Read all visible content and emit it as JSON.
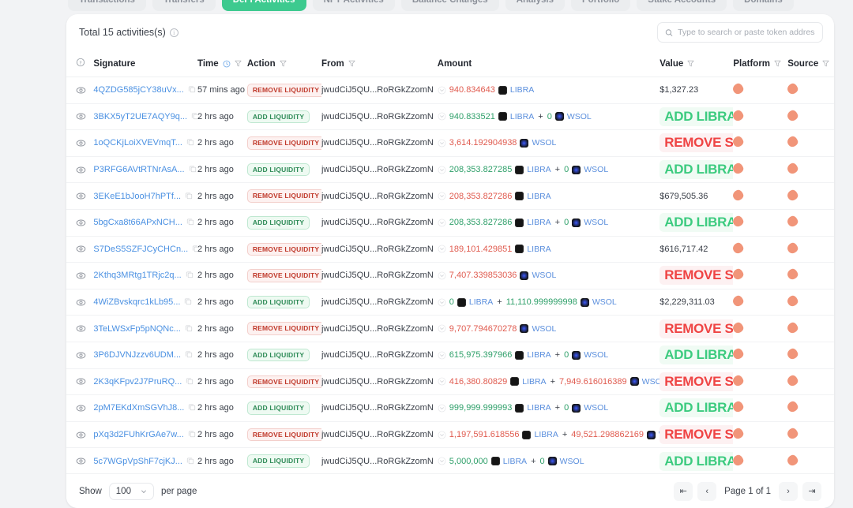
{
  "tabs": [
    {
      "label": "Transactions",
      "active": false
    },
    {
      "label": "Transfers",
      "active": false
    },
    {
      "label": "DeFi Activities",
      "active": true
    },
    {
      "label": "NFT Activities",
      "active": false
    },
    {
      "label": "Balance Changes",
      "active": false
    },
    {
      "label": "Analysis",
      "active": false
    },
    {
      "label": "Portfolio",
      "active": false
    },
    {
      "label": "Stake Accounts",
      "active": false
    },
    {
      "label": "Domains",
      "active": false
    }
  ],
  "header": {
    "total_label": "Total 15 activities(s)",
    "info_icon": "info-icon"
  },
  "search": {
    "placeholder": "Type to search or paste token address",
    "value": "",
    "icon": "search-icon"
  },
  "columns": [
    {
      "key": "eye",
      "label": ""
    },
    {
      "key": "signature",
      "label": "Signature"
    },
    {
      "key": "time",
      "label": "Time"
    },
    {
      "key": "action",
      "label": "Action"
    },
    {
      "key": "from",
      "label": "From"
    },
    {
      "key": "amount",
      "label": "Amount"
    },
    {
      "key": "value",
      "label": "Value"
    },
    {
      "key": "platform",
      "label": "Platform"
    },
    {
      "key": "source",
      "label": "Source"
    }
  ],
  "rows": [
    {
      "signature": "4QZDG585jCY38uVx...",
      "time": "57 mins ago",
      "action": "REMOVE LIQUIDITY",
      "action_type": "remove",
      "from": "jwudCiJ5QU...RoRGkZzomN",
      "amount": [
        {
          "num": "940.834643",
          "sign": "neg",
          "token": "LIBRA"
        }
      ],
      "value": "$1,327.23",
      "value_type": "plain",
      "platform": "platform-icon",
      "source": "source-icon"
    },
    {
      "signature": "3BKX5yT2UE7AQY9q...",
      "time": "2 hrs ago",
      "action": "ADD LIQUIDITY",
      "action_type": "add",
      "from": "jwudCiJ5QU...RoRGkZzomN",
      "amount": [
        {
          "num": "940.833521",
          "sign": "pos",
          "token": "LIBRA"
        },
        {
          "num": "0",
          "sign": "pos",
          "token": "WSOL"
        }
      ],
      "value": "ADD LIBRA",
      "value_type": "add",
      "platform": "platform-icon",
      "source": "source-icon"
    },
    {
      "signature": "1oQCKjLoiXVEVmqT...",
      "time": "2 hrs ago",
      "action": "REMOVE LIQUIDITY",
      "action_type": "remove",
      "from": "jwudCiJ5QU...RoRGkZzomN",
      "amount": [
        {
          "num": "3,614.192904938",
          "sign": "neg",
          "token": "WSOL"
        }
      ],
      "value": "REMOVE SOL",
      "value_type": "remove",
      "platform": "platform-icon",
      "source": "source-icon"
    },
    {
      "signature": "P3RFG6AVtRTNrAsA...",
      "time": "2 hrs ago",
      "action": "ADD LIQUIDITY",
      "action_type": "add",
      "from": "jwudCiJ5QU...RoRGkZzomN",
      "amount": [
        {
          "num": "208,353.827285",
          "sign": "pos",
          "token": "LIBRA"
        },
        {
          "num": "0",
          "sign": "pos",
          "token": "WSOL"
        }
      ],
      "value": "ADD LIBRA",
      "value_type": "add",
      "platform": "platform-icon",
      "source": "source-icon"
    },
    {
      "signature": "3EKeE1bJooH7hPTf...",
      "time": "2 hrs ago",
      "action": "REMOVE LIQUIDITY",
      "action_type": "remove",
      "from": "jwudCiJ5QU...RoRGkZzomN",
      "amount": [
        {
          "num": "208,353.827286",
          "sign": "neg",
          "token": "LIBRA"
        }
      ],
      "value": "$679,505.36",
      "value_type": "plain",
      "platform": "platform-icon",
      "source": "source-icon"
    },
    {
      "signature": "5bgCxa8t66APxNCH...",
      "time": "2 hrs ago",
      "action": "ADD LIQUIDITY",
      "action_type": "add",
      "from": "jwudCiJ5QU...RoRGkZzomN",
      "amount": [
        {
          "num": "208,353.827286",
          "sign": "pos",
          "token": "LIBRA"
        },
        {
          "num": "0",
          "sign": "pos",
          "token": "WSOL"
        }
      ],
      "value": "ADD LIBRA",
      "value_type": "add",
      "platform": "platform-icon",
      "source": "source-icon"
    },
    {
      "signature": "S7DeS5SZFJCyCHCn...",
      "time": "2 hrs ago",
      "action": "REMOVE LIQUIDITY",
      "action_type": "remove",
      "from": "jwudCiJ5QU...RoRGkZzomN",
      "amount": [
        {
          "num": "189,101.429851",
          "sign": "neg",
          "token": "LIBRA"
        }
      ],
      "value": "$616,717.42",
      "value_type": "plain",
      "platform": "platform-icon",
      "source": "source-icon"
    },
    {
      "signature": "2Kthq3MRtg1TRjc2q...",
      "time": "2 hrs ago",
      "action": "REMOVE LIQUIDITY",
      "action_type": "remove",
      "from": "jwudCiJ5QU...RoRGkZzomN",
      "amount": [
        {
          "num": "7,407.339853036",
          "sign": "neg",
          "token": "WSOL"
        }
      ],
      "value": "REMOVE SOL",
      "value_type": "remove",
      "platform": "platform-icon",
      "source": "source-icon"
    },
    {
      "signature": "4WiZBvskqrc1kLb95...",
      "time": "2 hrs ago",
      "action": "ADD LIQUIDITY",
      "action_type": "add",
      "from": "jwudCiJ5QU...RoRGkZzomN",
      "amount": [
        {
          "num": "0",
          "sign": "pos",
          "token": "LIBRA"
        },
        {
          "num": "11,110.999999998",
          "sign": "pos",
          "token": "WSOL"
        }
      ],
      "value": "$2,229,311.03",
      "value_type": "plain",
      "platform": "platform-icon",
      "source": "source-icon"
    },
    {
      "signature": "3TeLWSxFp5pNQNc...",
      "time": "2 hrs ago",
      "action": "REMOVE LIQUIDITY",
      "action_type": "remove",
      "from": "jwudCiJ5QU...RoRGkZzomN",
      "amount": [
        {
          "num": "9,707.794670278",
          "sign": "neg",
          "token": "WSOL"
        }
      ],
      "value": "REMOVE SOL",
      "value_type": "remove",
      "platform": "platform-icon",
      "source": "source-icon"
    },
    {
      "signature": "3P6DJVNJzzv6UDM...",
      "time": "2 hrs ago",
      "action": "ADD LIQUIDITY",
      "action_type": "add",
      "from": "jwudCiJ5QU...RoRGkZzomN",
      "amount": [
        {
          "num": "615,975.397966",
          "sign": "pos",
          "token": "LIBRA"
        },
        {
          "num": "0",
          "sign": "pos",
          "token": "WSOL"
        }
      ],
      "value": "ADD LIBRA",
      "value_type": "add",
      "platform": "platform-icon",
      "source": "source-icon"
    },
    {
      "signature": "2K3qKFpv2J7PruRQ...",
      "time": "2 hrs ago",
      "action": "REMOVE LIQUIDITY",
      "action_type": "remove",
      "from": "jwudCiJ5QU...RoRGkZzomN",
      "amount": [
        {
          "num": "416,380.80829",
          "sign": "neg",
          "token": "LIBRA"
        },
        {
          "num": "7,949.616016389",
          "sign": "neg",
          "token": "WSOL"
        }
      ],
      "value": "REMOVE SOL",
      "value_type": "remove",
      "platform": "platform-icon",
      "source": "source-icon"
    },
    {
      "signature": "2pM7EKdXmSGVhJ8...",
      "time": "2 hrs ago",
      "action": "ADD LIQUIDITY",
      "action_type": "add",
      "from": "jwudCiJ5QU...RoRGkZzomN",
      "amount": [
        {
          "num": "999,999.999993",
          "sign": "pos",
          "token": "LIBRA"
        },
        {
          "num": "0",
          "sign": "pos",
          "token": "WSOL"
        }
      ],
      "value": "ADD LIBRA",
      "value_type": "add",
      "platform": "platform-icon",
      "source": "source-icon"
    },
    {
      "signature": "pXq3d2FUhKrGAe7w...",
      "time": "2 hrs ago",
      "action": "REMOVE LIQUIDITY",
      "action_type": "remove",
      "from": "jwudCiJ5QU...RoRGkZzomN",
      "amount": [
        {
          "num": "1,197,591.618556",
          "sign": "neg",
          "token": "LIBRA"
        },
        {
          "num": "49,521.298862169",
          "sign": "neg",
          "token": "WSOL"
        }
      ],
      "value": "REMOVE SOL",
      "value_type": "remove",
      "platform": "platform-icon",
      "source": "source-icon"
    },
    {
      "signature": "5c7WGpVpShF7cjKJ...",
      "time": "2 hrs ago",
      "action": "ADD LIQUIDITY",
      "action_type": "add",
      "from": "jwudCiJ5QU...RoRGkZzomN",
      "amount": [
        {
          "num": "5,000,000",
          "sign": "pos",
          "token": "LIBRA"
        },
        {
          "num": "0",
          "sign": "pos",
          "token": "WSOL"
        }
      ],
      "value": "ADD LIBRA",
      "value_type": "add",
      "platform": "platform-icon",
      "source": "source-icon"
    }
  ],
  "footer": {
    "show_label": "Show",
    "page_size": "100",
    "per_page_label": "per page",
    "page_info": "Page 1 of 1",
    "first_label": "⇤",
    "prev_label": "‹",
    "next_label": "›",
    "last_label": "⇥"
  },
  "colors": {
    "accent_green": "#3dca8f",
    "value_add": "#3ccb7f",
    "value_remove": "#ef4444",
    "link_blue": "#4a90e2",
    "amount_neg": "#e05b4f",
    "amount_pos": "#2fa06a",
    "platform_blob": "#f08a6a"
  }
}
